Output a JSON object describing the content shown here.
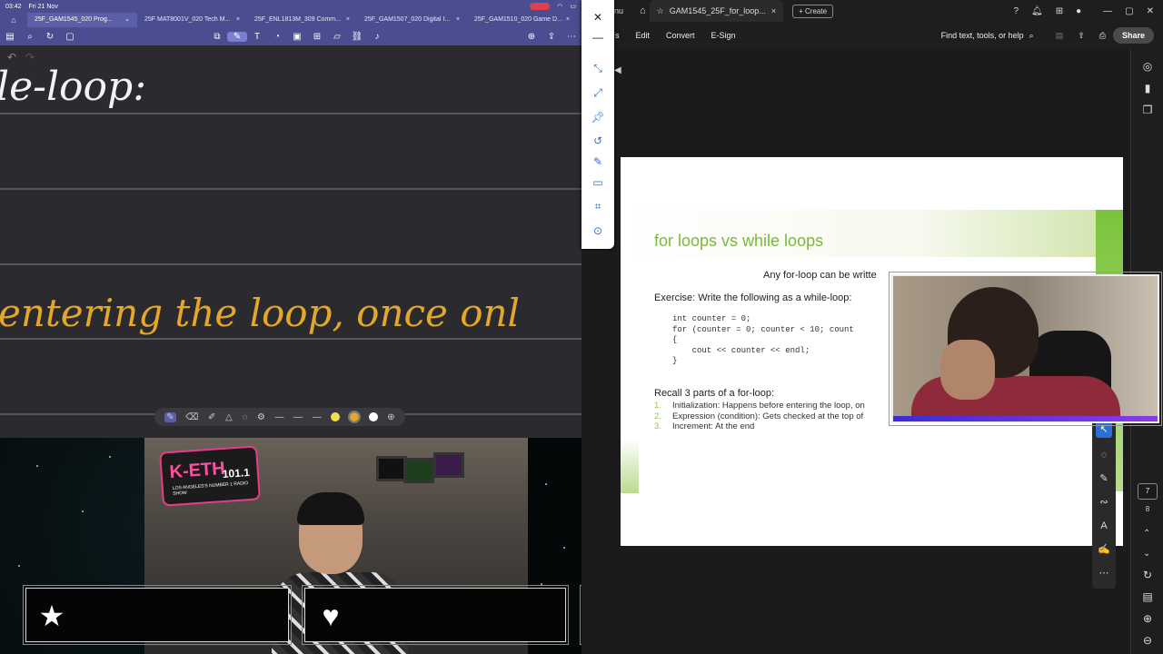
{
  "ipad": {
    "time": "03:42",
    "date": "Fri 21 Nov",
    "tabs": [
      {
        "label": "25F_GAM1545_020 Prog..."
      },
      {
        "label": "25F MAT8001V_020 Tech M..."
      },
      {
        "label": "25F_ENL1813M_309 Comm..."
      },
      {
        "label": "25F_GAM1507_020 Digital I..."
      },
      {
        "label": "25F_GAM1510_020 Game D..."
      }
    ],
    "handwriting_line1": "le-loop:",
    "handwriting_line2": "entering the loop, once onl"
  },
  "acrobat": {
    "tab_title": "GAM1545_25F_for_loop...",
    "tab_prefix": "nu",
    "create_label": "Create",
    "menu": [
      "s",
      "Edit",
      "Convert",
      "E-Sign"
    ],
    "find_label": "Find text, tools, or help",
    "share_label": "Share",
    "page_current": "7",
    "page_total": "8"
  },
  "slide": {
    "title": "for loops vs while loops",
    "subtitle": "Any for-loop can be writte",
    "exercise": "Exercise: Write the following as a while-loop:",
    "code": "int counter = 0;\nfor (counter = 0; counter < 10; count\n{\n    cout << counter << endl;\n}",
    "recall": "Recall 3 parts of a for-loop:",
    "list": [
      {
        "num": "1.",
        "text": "Initialization: Happens before entering the loop, on"
      },
      {
        "num": "2.",
        "text": "Expression (condition): Gets checked at the top of"
      },
      {
        "num": "3.",
        "text": "Increment: At the end"
      }
    ]
  },
  "radio": {
    "name": "K-ETH",
    "freq": "101.1",
    "tag": "LOS ANGELES'S NUMBER 1 RADIO SHOW"
  },
  "colors": {
    "accent_green": "#7cb83a",
    "ipad_bar": "#4a4d8f",
    "handwriting_yellow": "#e3a72a"
  },
  "alerts": [
    {
      "icon": "star-icon"
    },
    {
      "icon": "heart-icon"
    },
    {
      "icon": "add-user-icon"
    },
    {
      "icon": "dollar-icon"
    }
  ]
}
